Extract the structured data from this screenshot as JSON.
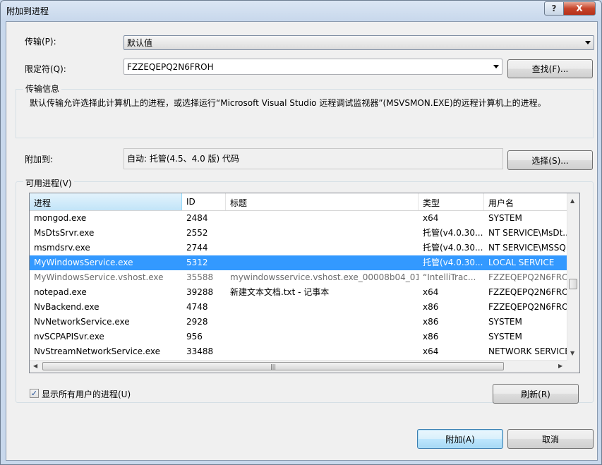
{
  "window": {
    "title": "附加到进程",
    "help_label": "?",
    "close_label": "X"
  },
  "transport": {
    "label": "传输(P):",
    "value": "默认值"
  },
  "qualifier": {
    "label": "限定符(Q):",
    "value": "FZZEQEPQ2N6FROH",
    "find_button": "查找(F)..."
  },
  "transport_info": {
    "title": "传输信息",
    "text": "默认传输允许选择此计算机上的进程，或选择运行“Microsoft Visual Studio 远程调试监视器”(MSVSMON.EXE)的远程计算机上的进程。"
  },
  "attach_to": {
    "label": "附加到:",
    "value": "自动: 托管(4.5、4.0 版) 代码",
    "select_button": "选择(S)..."
  },
  "processes": {
    "title": "可用进程(V)",
    "columns": [
      "进程",
      "ID",
      "标题",
      "类型",
      "用户名"
    ],
    "rows": [
      {
        "name": "mongod.exe",
        "id": "2484",
        "title": "",
        "type": "x64",
        "user": "SYSTEM"
      },
      {
        "name": "MsDtsSrvr.exe",
        "id": "2552",
        "title": "",
        "type": "托管(v4.0.30...",
        "user": "NT SERVICE\\MsDt..."
      },
      {
        "name": "msmdsrv.exe",
        "id": "2744",
        "title": "",
        "type": "托管(v4.0.30...",
        "user": "NT SERVICE\\MSSQ"
      },
      {
        "name": "MyWindowsService.exe",
        "id": "5312",
        "title": "",
        "type": "托管(v4.0.30...",
        "user": "LOCAL SERVICE"
      },
      {
        "name": "MyWindowsService.vshost.exe",
        "id": "35588",
        "title": "mywindowsservice.vshost.exe_00008b04_01...",
        "type": "“IntelliTrac...",
        "user": "FZZEQEPQ2N6FRO..."
      },
      {
        "name": "notepad.exe",
        "id": "39288",
        "title": "新建文本文档.txt - 记事本",
        "type": "x64",
        "user": "FZZEQEPQ2N6FRO..."
      },
      {
        "name": "NvBackend.exe",
        "id": "4748",
        "title": "",
        "type": "x86",
        "user": "FZZEQEPQ2N6FRO..."
      },
      {
        "name": "NvNetworkService.exe",
        "id": "2928",
        "title": "",
        "type": "x86",
        "user": "SYSTEM"
      },
      {
        "name": "nvSCPAPISvr.exe",
        "id": "956",
        "title": "",
        "type": "x86",
        "user": "SYSTEM"
      },
      {
        "name": "NvStreamNetworkService.exe",
        "id": "33488",
        "title": "",
        "type": "x64",
        "user": "NETWORK SERVICE"
      }
    ]
  },
  "show_all_users": {
    "label": "显示所有用户的进程(U)",
    "checked": true,
    "check_glyph": "✓"
  },
  "refresh_button": "刷新(R)",
  "attach_button": "附加(A)",
  "cancel_button": "取消",
  "scroll_glyphs": {
    "up": "▲",
    "down": "▼",
    "left": "◀",
    "right": "▶",
    "grip": "|||"
  }
}
